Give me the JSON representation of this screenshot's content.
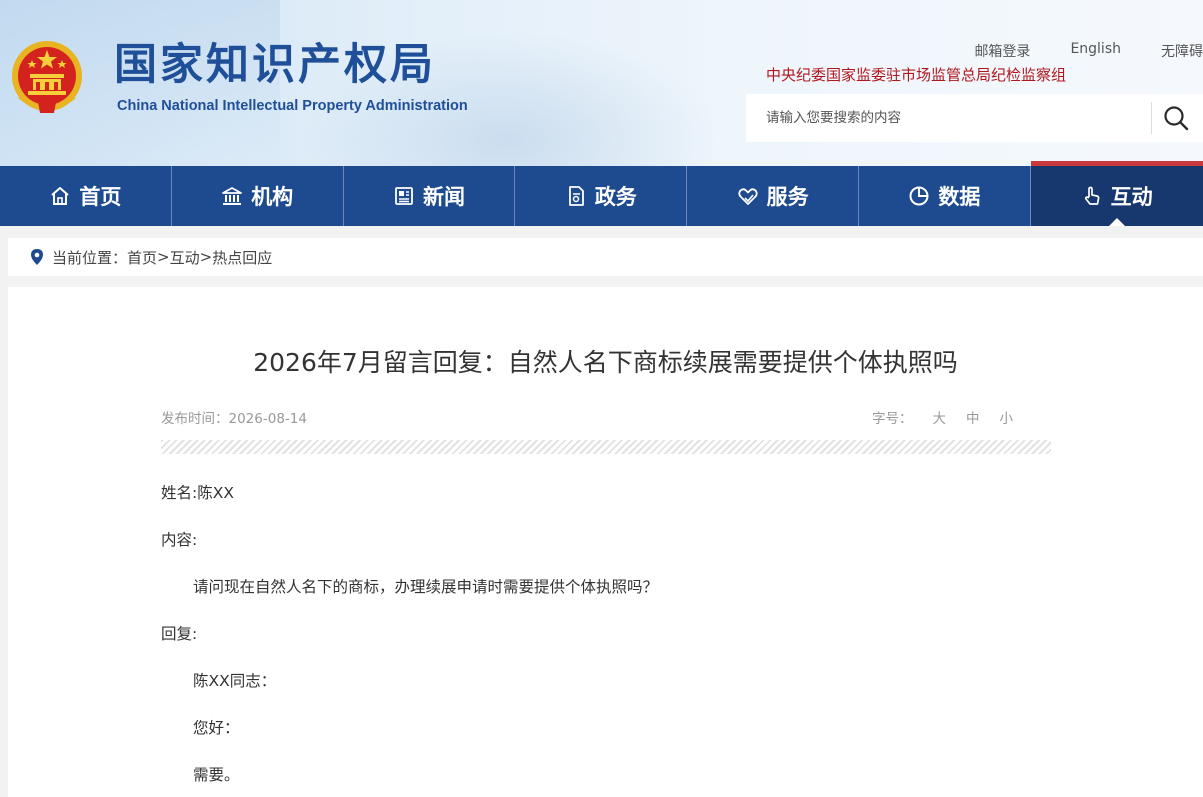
{
  "header": {
    "logo_cn": "国家知识产权局",
    "logo_en": "China National Intellectual Property Administration",
    "top_links": [
      "邮箱登录",
      "English",
      "无障碍"
    ],
    "notice": "中央纪委国家监委驻市场监管总局纪检监察组",
    "search_placeholder": "请输入您要搜索的内容",
    "search_icon": "search-icon"
  },
  "nav": {
    "items": [
      {
        "label": "首页",
        "icon": "home-icon"
      },
      {
        "label": "机构",
        "icon": "institution-icon"
      },
      {
        "label": "新闻",
        "icon": "news-icon"
      },
      {
        "label": "政务",
        "icon": "document-icon"
      },
      {
        "label": "服务",
        "icon": "heart-hand-icon"
      },
      {
        "label": "数据",
        "icon": "pie-chart-icon"
      },
      {
        "label": "互动",
        "icon": "hand-pointer-icon"
      }
    ],
    "active_index": 6
  },
  "breadcrumb": {
    "prefix": "当前位置：",
    "items": [
      "首页",
      "互动",
      "热点回应"
    ],
    "separator": ">"
  },
  "article": {
    "title": "2026年7月留言回复：自然人名下商标续展需要提供个体执照吗",
    "publish_label": "发布时间：",
    "publish_date": "2026-08-14",
    "font_label": "字号：",
    "font_sizes": [
      "大",
      "中",
      "小"
    ],
    "name_line": "姓名:陈XX",
    "content_label": "内容:",
    "question": "请问现在自然人名下的商标，办理续展申请时需要提供个体执照吗？",
    "reply_label": "回复:",
    "salutation": "陈XX同志：",
    "greeting": "您好：",
    "answer": "需要。"
  },
  "colors": {
    "nav_bg": "#1e4b8f",
    "nav_active": "#16386f",
    "brand_blue": "#1f4f98",
    "notice_red": "#b0171d"
  }
}
